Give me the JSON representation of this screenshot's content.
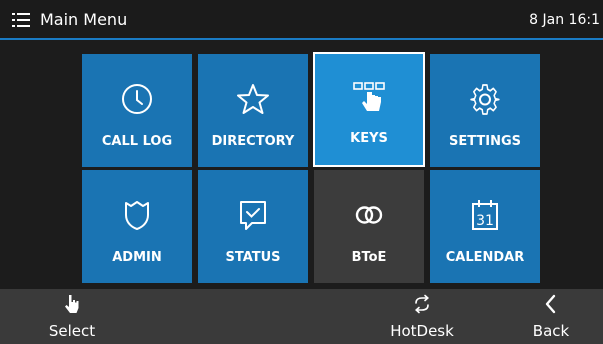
{
  "header": {
    "title": "Main Menu",
    "date_time": "8 Jan 16:1"
  },
  "tiles": [
    {
      "label": "CALL LOG",
      "icon": "clock-icon"
    },
    {
      "label": "DIRECTORY",
      "icon": "star-icon"
    },
    {
      "label": "KEYS",
      "icon": "keys-hand-icon",
      "selected": true
    },
    {
      "label": "SETTINGS",
      "icon": "gear-icon"
    },
    {
      "label": "ADMIN",
      "icon": "shield-icon"
    },
    {
      "label": "STATUS",
      "icon": "status-check-icon"
    },
    {
      "label": "BToE",
      "icon": "linked-rings-icon"
    },
    {
      "label": "CALENDAR",
      "icon": "calendar-icon",
      "icon_text": "31"
    }
  ],
  "softkeys": {
    "select": {
      "label": "Select",
      "icon": "hand-pointer-icon"
    },
    "hotdesk": {
      "label": "HotDesk",
      "icon": "swap-arrows-icon"
    },
    "back": {
      "label": "Back",
      "icon": "chevron-left-icon"
    }
  },
  "colors": {
    "tile": "#1a74b3",
    "tile_selected": "#1f8fd4",
    "tile_btoe": "#3c3c3c",
    "accent_line": "#1a7bc4",
    "softbar": "#3a3a3a"
  }
}
